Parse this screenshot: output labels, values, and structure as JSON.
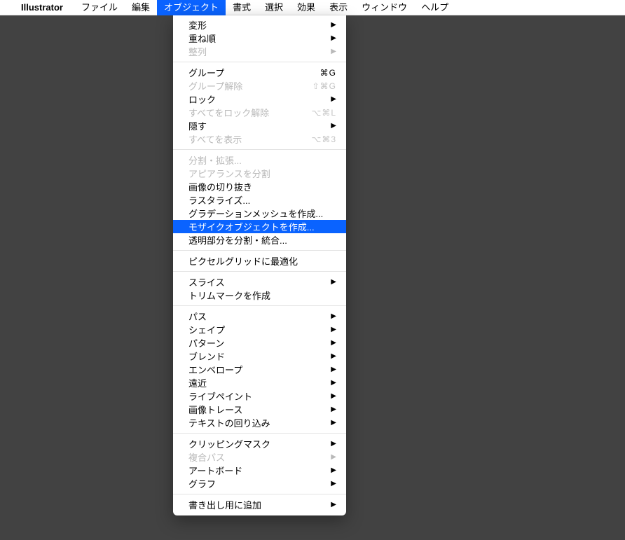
{
  "menubar": {
    "apple_icon": "",
    "app_name": "Illustrator",
    "items": [
      {
        "label": "ファイル"
      },
      {
        "label": "編集"
      },
      {
        "label": "オブジェクト"
      },
      {
        "label": "書式"
      },
      {
        "label": "選択"
      },
      {
        "label": "効果"
      },
      {
        "label": "表示"
      },
      {
        "label": "ウィンドウ"
      },
      {
        "label": "ヘルプ"
      }
    ]
  },
  "dropdown": [
    {
      "type": "item",
      "label": "変形",
      "submenu": true
    },
    {
      "type": "item",
      "label": "重ね順",
      "submenu": true
    },
    {
      "type": "item",
      "label": "整列",
      "submenu": true,
      "disabled": true
    },
    {
      "type": "sep"
    },
    {
      "type": "item",
      "label": "グループ",
      "shortcut": "⌘G"
    },
    {
      "type": "item",
      "label": "グループ解除",
      "shortcut": "⇧⌘G",
      "disabled": true
    },
    {
      "type": "item",
      "label": "ロック",
      "submenu": true
    },
    {
      "type": "item",
      "label": "すべてをロック解除",
      "shortcut": "⌥⌘L",
      "disabled": true
    },
    {
      "type": "item",
      "label": "隠す",
      "submenu": true
    },
    {
      "type": "item",
      "label": "すべてを表示",
      "shortcut": "⌥⌘3",
      "disabled": true
    },
    {
      "type": "sep"
    },
    {
      "type": "item",
      "label": "分割・拡張...",
      "disabled": true
    },
    {
      "type": "item",
      "label": "アピアランスを分割",
      "disabled": true
    },
    {
      "type": "item",
      "label": "画像の切り抜き"
    },
    {
      "type": "item",
      "label": "ラスタライズ..."
    },
    {
      "type": "item",
      "label": "グラデーションメッシュを作成..."
    },
    {
      "type": "item",
      "label": "モザイクオブジェクトを作成...",
      "selected": true
    },
    {
      "type": "item",
      "label": "透明部分を分割・統合..."
    },
    {
      "type": "sep"
    },
    {
      "type": "item",
      "label": "ピクセルグリッドに最適化"
    },
    {
      "type": "sep"
    },
    {
      "type": "item",
      "label": "スライス",
      "submenu": true
    },
    {
      "type": "item",
      "label": "トリムマークを作成"
    },
    {
      "type": "sep"
    },
    {
      "type": "item",
      "label": "パス",
      "submenu": true
    },
    {
      "type": "item",
      "label": "シェイプ",
      "submenu": true
    },
    {
      "type": "item",
      "label": "パターン",
      "submenu": true
    },
    {
      "type": "item",
      "label": "ブレンド",
      "submenu": true
    },
    {
      "type": "item",
      "label": "エンベロープ",
      "submenu": true
    },
    {
      "type": "item",
      "label": "遠近",
      "submenu": true
    },
    {
      "type": "item",
      "label": "ライブペイント",
      "submenu": true
    },
    {
      "type": "item",
      "label": "画像トレース",
      "submenu": true
    },
    {
      "type": "item",
      "label": "テキストの回り込み",
      "submenu": true
    },
    {
      "type": "sep"
    },
    {
      "type": "item",
      "label": "クリッピングマスク",
      "submenu": true
    },
    {
      "type": "item",
      "label": "複合パス",
      "submenu": true,
      "disabled": true
    },
    {
      "type": "item",
      "label": "アートボード",
      "submenu": true
    },
    {
      "type": "item",
      "label": "グラフ",
      "submenu": true
    },
    {
      "type": "sep"
    },
    {
      "type": "item",
      "label": "書き出し用に追加",
      "submenu": true
    }
  ]
}
